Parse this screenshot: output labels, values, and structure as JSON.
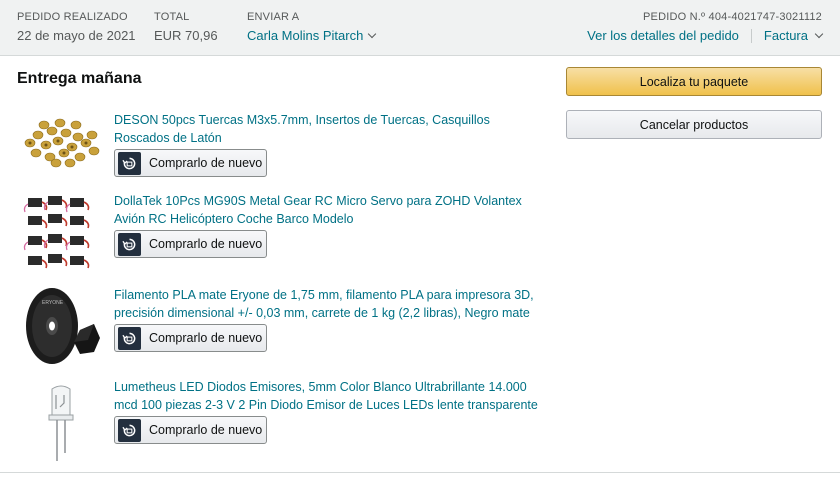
{
  "header": {
    "order_placed_label": "PEDIDO REALIZADO",
    "order_placed_value": "22 de mayo de 2021",
    "total_label": "TOTAL",
    "total_value": "EUR 70,96",
    "ship_to_label": "ENVIAR A",
    "ship_to_value": "Carla Molins Pitarch",
    "order_number": "PEDIDO N.º 404-4021747-3021112",
    "details_link": "Ver los detalles del pedido",
    "invoice_link": "Factura"
  },
  "delivery": {
    "title": "Entrega mañana"
  },
  "items": [
    {
      "title": "DESON 50pcs Tuercas M3x5.7mm, Insertos de Tuercas, Casquillos Roscados de Latón",
      "button": "Comprarlo de nuevo",
      "thumb_icon": "brass-inserts-image"
    },
    {
      "title": "DollaTek 10Pcs MG90S Metal Gear RC Micro Servo para ZOHD Volantex Avión RC Helicóptero Coche Barco Modelo",
      "button": "Comprarlo de nuevo",
      "thumb_icon": "servo-motors-image"
    },
    {
      "title": "Filamento PLA mate Eryone de 1,75 mm, filamento PLA para impresora 3D, precisión dimensional +/- 0,03 mm, carrete de 1 kg (2,2 libras), Negro mate",
      "button": "Comprarlo de nuevo",
      "thumb_icon": "filament-spool-image"
    },
    {
      "title": "Lumetheus LED Diodos Emisores, 5mm Color Blanco Ultrabrillante 14.000 mcd 100 piezas 2-3 V 2 Pin Diodo Emisor de Luces LEDs lente transparente",
      "button": "Comprarlo de nuevo",
      "thumb_icon": "led-diode-image"
    }
  ],
  "actions": {
    "track_package": "Localiza tu paquete",
    "cancel_items": "Cancelar productos"
  },
  "colors": {
    "link": "#007185",
    "primary_button": "#f0c14b",
    "header_bg": "#f0f2f2"
  }
}
